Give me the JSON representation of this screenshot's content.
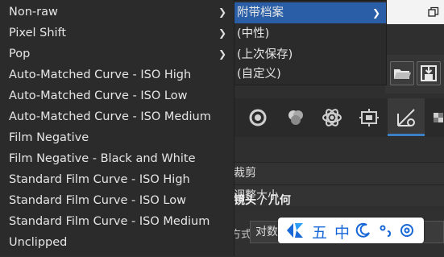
{
  "main_menu": {
    "items": [
      {
        "label": "Non-raw",
        "has_submenu": true
      },
      {
        "label": "Pixel Shift",
        "has_submenu": true
      },
      {
        "label": "Pop",
        "has_submenu": true
      },
      {
        "label": "Auto-Matched Curve - ISO High",
        "has_submenu": false
      },
      {
        "label": "Auto-Matched Curve - ISO Low",
        "has_submenu": false
      },
      {
        "label": "Auto-Matched Curve - ISO Medium",
        "has_submenu": false
      },
      {
        "label": "Film Negative",
        "has_submenu": false
      },
      {
        "label": "Film Negative - Black and White",
        "has_submenu": false
      },
      {
        "label": "Standard Film Curve - ISO High",
        "has_submenu": false
      },
      {
        "label": "Standard Film Curve - ISO Low",
        "has_submenu": false
      },
      {
        "label": "Standard Film Curve - ISO Medium",
        "has_submenu": false
      },
      {
        "label": "Unclipped",
        "has_submenu": false
      }
    ]
  },
  "submenu": {
    "items": [
      {
        "label": "附带档案",
        "active": true,
        "has_submenu": true
      },
      {
        "label": "(中性)",
        "active": false
      },
      {
        "label": "(上次保存)",
        "active": false
      },
      {
        "label": "(自定义)",
        "active": false
      }
    ]
  },
  "panel": {
    "rows": [
      {
        "label": "裁剪"
      },
      {
        "label": "调整大小"
      },
      {
        "label": "镜头 / 几何"
      }
    ],
    "select_label": "方式:",
    "select_value": "对数"
  },
  "toolbar": {
    "icons": [
      "open-folder-icon",
      "save-icon"
    ]
  },
  "tabs": {
    "icons": [
      "exposure-icon",
      "color-icon",
      "atom-icon",
      "raw-icon",
      "transform-icon",
      "checker-icon"
    ],
    "active_index": 4
  },
  "ime": {
    "chars": [
      "五",
      "中"
    ],
    "icons": [
      "moon-icon",
      "punctuation-icon",
      "settings-icon"
    ],
    "accent": "#1767d6"
  },
  "colors": {
    "menu_bg": "#2b2b2b",
    "highlight": "#2a5fa8",
    "text": "#e6e6e6"
  }
}
